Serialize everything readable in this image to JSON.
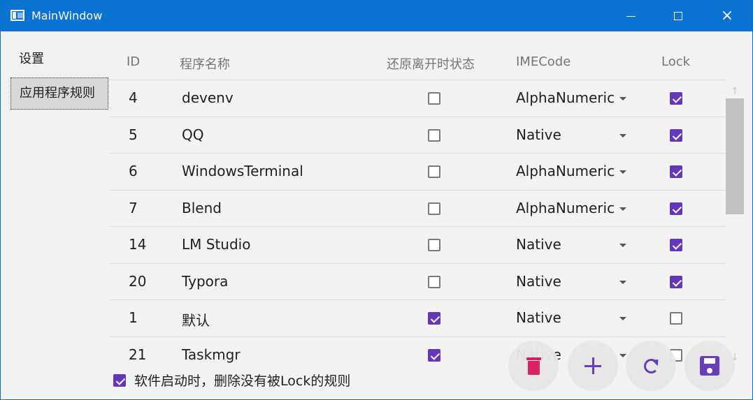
{
  "window": {
    "title": "MainWindow",
    "controls": {
      "minimize_icon": "minimize-icon",
      "maximize_icon": "maximize-icon",
      "close_icon": "close-icon"
    }
  },
  "sidebar": {
    "items": [
      {
        "label": "设置",
        "selected": false
      },
      {
        "label": "应用程序规则",
        "selected": true
      }
    ]
  },
  "table": {
    "columns": [
      "ID",
      "程序名称",
      "还原离开时状态",
      "IMECode",
      "Lock"
    ],
    "rows": [
      {
        "id": "4",
        "name": "devenv",
        "restore_state": false,
        "ime_code": "AlphaNumeric",
        "lock": true
      },
      {
        "id": "5",
        "name": "QQ",
        "restore_state": false,
        "ime_code": "Native",
        "lock": true
      },
      {
        "id": "6",
        "name": "WindowsTerminal",
        "restore_state": false,
        "ime_code": "AlphaNumeric",
        "lock": true
      },
      {
        "id": "7",
        "name": "Blend",
        "restore_state": false,
        "ime_code": "AlphaNumeric",
        "lock": true
      },
      {
        "id": "14",
        "name": "LM Studio",
        "restore_state": false,
        "ime_code": "Native",
        "lock": true
      },
      {
        "id": "20",
        "name": "Typora",
        "restore_state": false,
        "ime_code": "Native",
        "lock": true
      },
      {
        "id": "1",
        "name": "默认",
        "restore_state": true,
        "ime_code": "Native",
        "lock": false
      },
      {
        "id": "21",
        "name": "Taskmgr",
        "restore_state": true,
        "ime_code": "Native",
        "lock": false
      }
    ]
  },
  "option": {
    "label": "软件启动时，删除没有被Lock的规则",
    "checked": true
  },
  "actions": {
    "delete_icon": "trash-icon",
    "add_icon": "plus-icon",
    "refresh_icon": "refresh-icon",
    "save_icon": "save-icon"
  },
  "colors": {
    "titlebar": "#0a72d1",
    "accent": "#6437ba",
    "delete": "#d81b60"
  }
}
